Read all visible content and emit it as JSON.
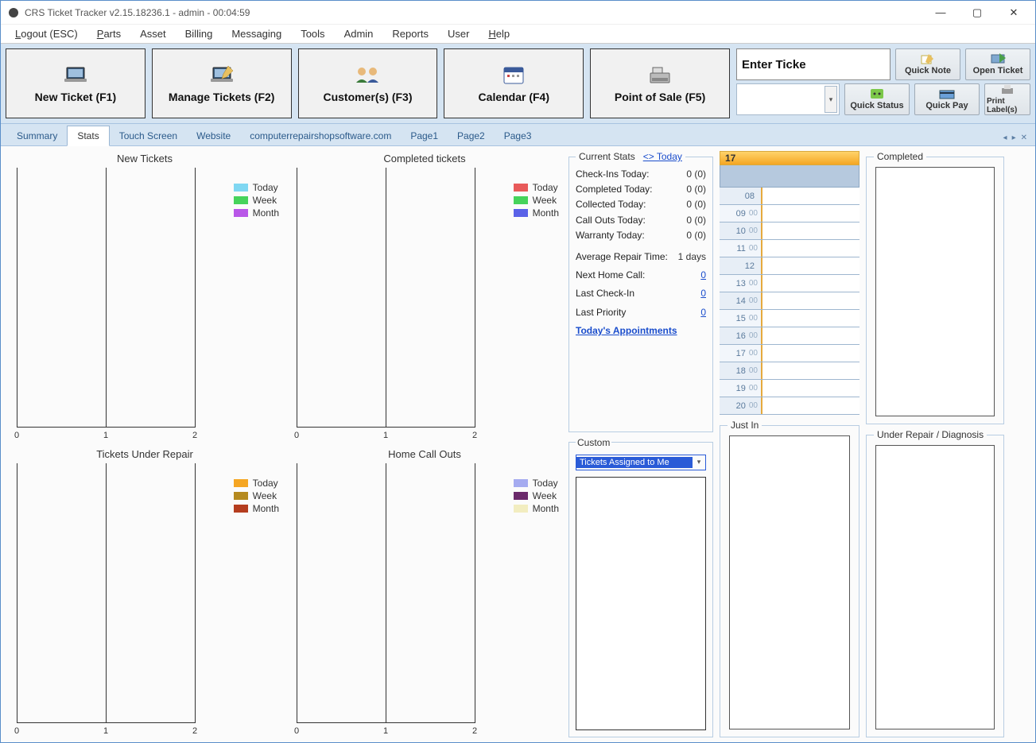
{
  "window": {
    "title": "CRS Ticket Tracker  v2.15.18236.1 - admin - 00:04:59"
  },
  "menu": {
    "logout": "Logout (ESC)",
    "parts": "Parts",
    "asset": "Asset",
    "billing": "Billing",
    "messaging": "Messaging",
    "tools": "Tools",
    "admin": "Admin",
    "reports": "Reports",
    "user": "User",
    "help": "Help"
  },
  "bigbuttons": {
    "new_ticket": "New Ticket (F1)",
    "manage_tickets": "Manage Tickets (F2)",
    "customers": "Customer(s) (F3)",
    "calendar": "Calendar (F4)",
    "pos": "Point of Sale (F5)"
  },
  "rightcluster": {
    "enter_ticket_placeholder": "Enter Ticke",
    "quick_note": "Quick Note",
    "open_ticket": "Open Ticket",
    "quick_status": "Quick Status",
    "quick_pay": "Quick Pay",
    "print_labels": "Print Label(s)"
  },
  "tabs": {
    "summary": "Summary",
    "stats": "Stats",
    "touch": "Touch Screen",
    "website": "Website",
    "crss": "computerrepairshopsoftware.com",
    "page1": "Page1",
    "page2": "Page2",
    "page3": "Page3"
  },
  "charts_labels": {
    "legend_today": "Today",
    "legend_week": "Week",
    "legend_month": "Month"
  },
  "chart_data": [
    {
      "id": "new_tickets",
      "title": "New Tickets",
      "type": "bar",
      "categories": [
        "0",
        "1",
        "2"
      ],
      "series": [
        {
          "name": "Today",
          "color": "#7fd7f2",
          "values": [
            0,
            0,
            0
          ]
        },
        {
          "name": "Week",
          "color": "#46d35b",
          "values": [
            0,
            0,
            0
          ]
        },
        {
          "name": "Month",
          "color": "#b957e8",
          "values": [
            0,
            0,
            0
          ]
        }
      ]
    },
    {
      "id": "completed_tickets",
      "title": "Completed tickets",
      "type": "bar",
      "categories": [
        "0",
        "1",
        "2"
      ],
      "series": [
        {
          "name": "Today",
          "color": "#e85a5a",
          "values": [
            0,
            0,
            0
          ]
        },
        {
          "name": "Week",
          "color": "#46d35b",
          "values": [
            0,
            0,
            0
          ]
        },
        {
          "name": "Month",
          "color": "#5a62e8",
          "values": [
            0,
            0,
            0
          ]
        }
      ]
    },
    {
      "id": "under_repair",
      "title": "Tickets Under Repair",
      "type": "bar",
      "categories": [
        "0",
        "1",
        "2"
      ],
      "series": [
        {
          "name": "Today",
          "color": "#f5a623",
          "values": [
            0,
            0,
            0
          ]
        },
        {
          "name": "Week",
          "color": "#b58a1f",
          "values": [
            0,
            0,
            0
          ]
        },
        {
          "name": "Month",
          "color": "#b53d1f",
          "values": [
            0,
            0,
            0
          ]
        }
      ]
    },
    {
      "id": "home_callouts",
      "title": "Home Call Outs",
      "type": "bar",
      "categories": [
        "0",
        "1",
        "2"
      ],
      "series": [
        {
          "name": "Today",
          "color": "#a5abf0",
          "values": [
            0,
            0,
            0
          ]
        },
        {
          "name": "Week",
          "color": "#6b2a6b",
          "values": [
            0,
            0,
            0
          ]
        },
        {
          "name": "Month",
          "color": "#f2edc0",
          "values": [
            0,
            0,
            0
          ]
        }
      ]
    }
  ],
  "current_stats": {
    "legend": "Current Stats",
    "today_link": "<> Today",
    "rows": {
      "checkins": {
        "label": "Check-Ins Today:",
        "value": "0 (0)"
      },
      "completed": {
        "label": "Completed Today:",
        "value": "0 (0)"
      },
      "collected": {
        "label": "Collected Today:",
        "value": "0 (0)"
      },
      "callouts": {
        "label": "Call Outs Today:",
        "value": "0 (0)"
      },
      "warranty": {
        "label": "Warranty Today:",
        "value": "0 (0)"
      },
      "avg_repair": {
        "label": "Average Repair Time:",
        "value": "1 days"
      },
      "next_home": {
        "label": "Next Home Call:",
        "value": "0"
      },
      "last_checkin": {
        "label": "Last Check-In",
        "value": "0"
      },
      "last_priority": {
        "label": "Last Priority",
        "value": "0"
      }
    },
    "appointments_link": "Today's Appointments"
  },
  "custom_panel": {
    "legend": "Custom",
    "selected": "Tickets Assigned to Me"
  },
  "schedule": {
    "date_label": "17",
    "hours": [
      {
        "hh": "08",
        "mm": ""
      },
      {
        "hh": "09",
        "mm": "00"
      },
      {
        "hh": "10",
        "mm": "00"
      },
      {
        "hh": "11",
        "mm": "00"
      },
      {
        "hh": "12",
        "mm": ""
      },
      {
        "hh": "13",
        "mm": "00"
      },
      {
        "hh": "14",
        "mm": "00"
      },
      {
        "hh": "15",
        "mm": "00"
      },
      {
        "hh": "16",
        "mm": "00"
      },
      {
        "hh": "17",
        "mm": "00"
      },
      {
        "hh": "18",
        "mm": "00"
      },
      {
        "hh": "19",
        "mm": "00"
      },
      {
        "hh": "20",
        "mm": "00"
      }
    ]
  },
  "panels": {
    "completed": "Completed",
    "justin": "Just In",
    "under_repair": "Under Repair / Diagnosis"
  }
}
